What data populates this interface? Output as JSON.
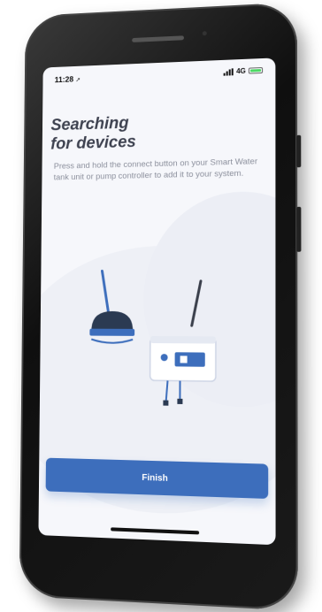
{
  "status_bar": {
    "time": "11:28",
    "network": "4G"
  },
  "main": {
    "title_line1": "Searching",
    "title_line2": "for devices",
    "instructions": "Press and hold the connect button on your Smart Water tank unit or pump controller to add it to your system."
  },
  "actions": {
    "finish_label": "Finish"
  },
  "colors": {
    "accent": "#3d6ebc",
    "title": "#3e4250",
    "body_text": "#8b8f9c",
    "screen_bg": "#f6f7fb"
  },
  "icons": {
    "signal": "cellular-signal-icon",
    "battery": "battery-icon",
    "location": "location-arrow-icon",
    "illustration": "smart-water-devices-illustration"
  }
}
